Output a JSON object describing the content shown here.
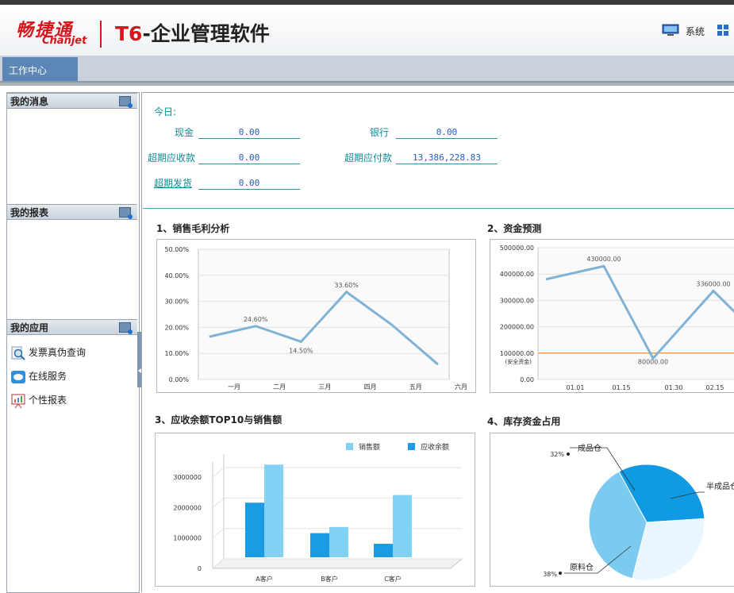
{
  "header": {
    "logo_cn": "畅捷通",
    "logo_en": "Chanjet",
    "product_title_t": "T6",
    "product_title_rest": "-企业管理软件",
    "system_label": "系统"
  },
  "tabs": [
    {
      "label": "工作中心"
    }
  ],
  "sidebar": {
    "messages_title": "我的消息",
    "reports_title": "我的报表",
    "apps_title": "我的应用",
    "apps": [
      {
        "label": "发票真伪查询",
        "icon": "invoice-search-icon"
      },
      {
        "label": "在线服务",
        "icon": "online-service-icon"
      },
      {
        "label": "个性报表",
        "icon": "custom-report-icon"
      }
    ]
  },
  "today": {
    "title": "今日:",
    "cash_label": "现金",
    "cash_value": "0.00",
    "bank_label": "银行",
    "bank_value": "0.00",
    "receivable_label": "超期应收款",
    "receivable_value": "0.00",
    "payable_label": "超期应付款",
    "payable_value": "13,386,228.83",
    "shipment_label": "超期发货",
    "shipment_value": "0.00"
  },
  "colors": {
    "teal": "#0d8b96",
    "line": "#7fb2d4",
    "bar_dark": "#1a9be3",
    "bar_light": "#82d1f2",
    "brand_red": "#d7141b"
  },
  "chart_data": [
    {
      "id": "margin",
      "title": "1、销售毛利分析",
      "type": "line",
      "categories": [
        "一月",
        "二月",
        "三月",
        "四月",
        "五月",
        "六月"
      ],
      "values": [
        16.5,
        20.5,
        14.5,
        33.6,
        21.0,
        6.0
      ],
      "point_labels": [
        "",
        "24.60%",
        "14.50%",
        "33.60%",
        "",
        ""
      ],
      "yticks": [
        "0.00%",
        "10.00%",
        "20.00%",
        "30.00%",
        "40.00%",
        "50.00%"
      ],
      "ylim": [
        0,
        50
      ]
    },
    {
      "id": "cashflow",
      "title": "2、资金预测",
      "type": "line",
      "categories": [
        "01.01",
        "01.15",
        "01.30",
        "02.15"
      ],
      "values": [
        380000,
        430000,
        80000,
        336000,
        250000
      ],
      "point_labels": [
        "",
        "430000.00",
        "80000.00",
        "336000.00",
        ""
      ],
      "yticks": [
        "0.00",
        "100000.00",
        "200000.00",
        "300000.00",
        "400000.00",
        "500000.00"
      ],
      "safety_label": "(安全资金)",
      "safety_value": 100000,
      "ylim": [
        0,
        500000
      ]
    },
    {
      "id": "receivable",
      "title": "3、应收余额TOP10与销售额",
      "type": "bar",
      "categories": [
        "A客户",
        "B客户",
        "C客户"
      ],
      "series": [
        {
          "name": "销售额",
          "values": [
            3100000,
            1050000,
            2100000
          ]
        },
        {
          "name": "应收余额",
          "values": [
            1900000,
            900000,
            550000
          ]
        }
      ],
      "yticks": [
        "0",
        "1000000",
        "2000000",
        "3000000"
      ],
      "ylim": [
        0,
        3500000
      ]
    },
    {
      "id": "inventory",
      "title": "4、库存资金占用",
      "type": "pie",
      "slices": [
        {
          "name": "成品仓",
          "pct_label": "32%",
          "value": 32
        },
        {
          "name": "半成品仓",
          "pct_label": "",
          "value": 30
        },
        {
          "name": "原料仓",
          "pct_label": "38%",
          "value": 38
        }
      ]
    }
  ]
}
